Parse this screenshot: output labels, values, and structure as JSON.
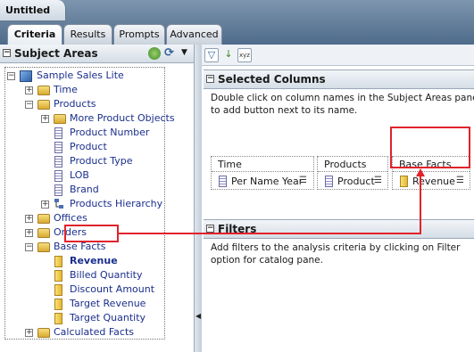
{
  "window": {
    "title": "Untitled"
  },
  "tabs": [
    {
      "label": "Criteria",
      "active": true
    },
    {
      "label": "Results"
    },
    {
      "label": "Prompts"
    },
    {
      "label": "Advanced"
    }
  ],
  "subject_areas": {
    "header": "Subject Areas",
    "collapse_symbol": "⊟"
  },
  "tree": {
    "root": "Sample Sales Lite",
    "items": [
      {
        "label": "Time",
        "icon": "folder-icon"
      },
      {
        "label": "Products",
        "icon": "folder-icon"
      },
      {
        "label": "More Product Objects",
        "icon": "folder-icon"
      },
      {
        "label": "Product Number",
        "icon": "column-icon"
      },
      {
        "label": "Product",
        "icon": "column-icon"
      },
      {
        "label": "Product Type",
        "icon": "column-icon"
      },
      {
        "label": "LOB",
        "icon": "column-icon"
      },
      {
        "label": "Brand",
        "icon": "column-icon"
      },
      {
        "label": "Products Hierarchy",
        "icon": "hierarchy-icon"
      },
      {
        "label": "Offices",
        "icon": "folder-icon"
      },
      {
        "label": "Orders",
        "icon": "folder-icon"
      },
      {
        "label": "Base Facts",
        "icon": "folder-icon"
      },
      {
        "label": "Revenue",
        "icon": "measure-icon",
        "highlighted": true
      },
      {
        "label": "Billed Quantity",
        "icon": "measure-icon"
      },
      {
        "label": "Discount Amount",
        "icon": "measure-icon"
      },
      {
        "label": "Target Revenue",
        "icon": "measure-icon"
      },
      {
        "label": "Target Quantity",
        "icon": "measure-icon"
      },
      {
        "label": "Calculated Facts",
        "icon": "folder-icon"
      }
    ]
  },
  "selected_columns": {
    "header": "Selected Columns",
    "description": "Double click on column names in the Subject Areas pane to add button next to its name.",
    "columns": [
      {
        "group": "Time",
        "item": "Per Name Year"
      },
      {
        "group": "Products",
        "item": "Product"
      },
      {
        "group": "Base Facts",
        "item": "Revenue"
      }
    ]
  },
  "filters": {
    "header": "Filters",
    "description": "Add filters to the analysis criteria by clicking on Filter option for catalog pane."
  },
  "colors": {
    "highlight": "#e0232c",
    "link": "#1a2e8c"
  }
}
